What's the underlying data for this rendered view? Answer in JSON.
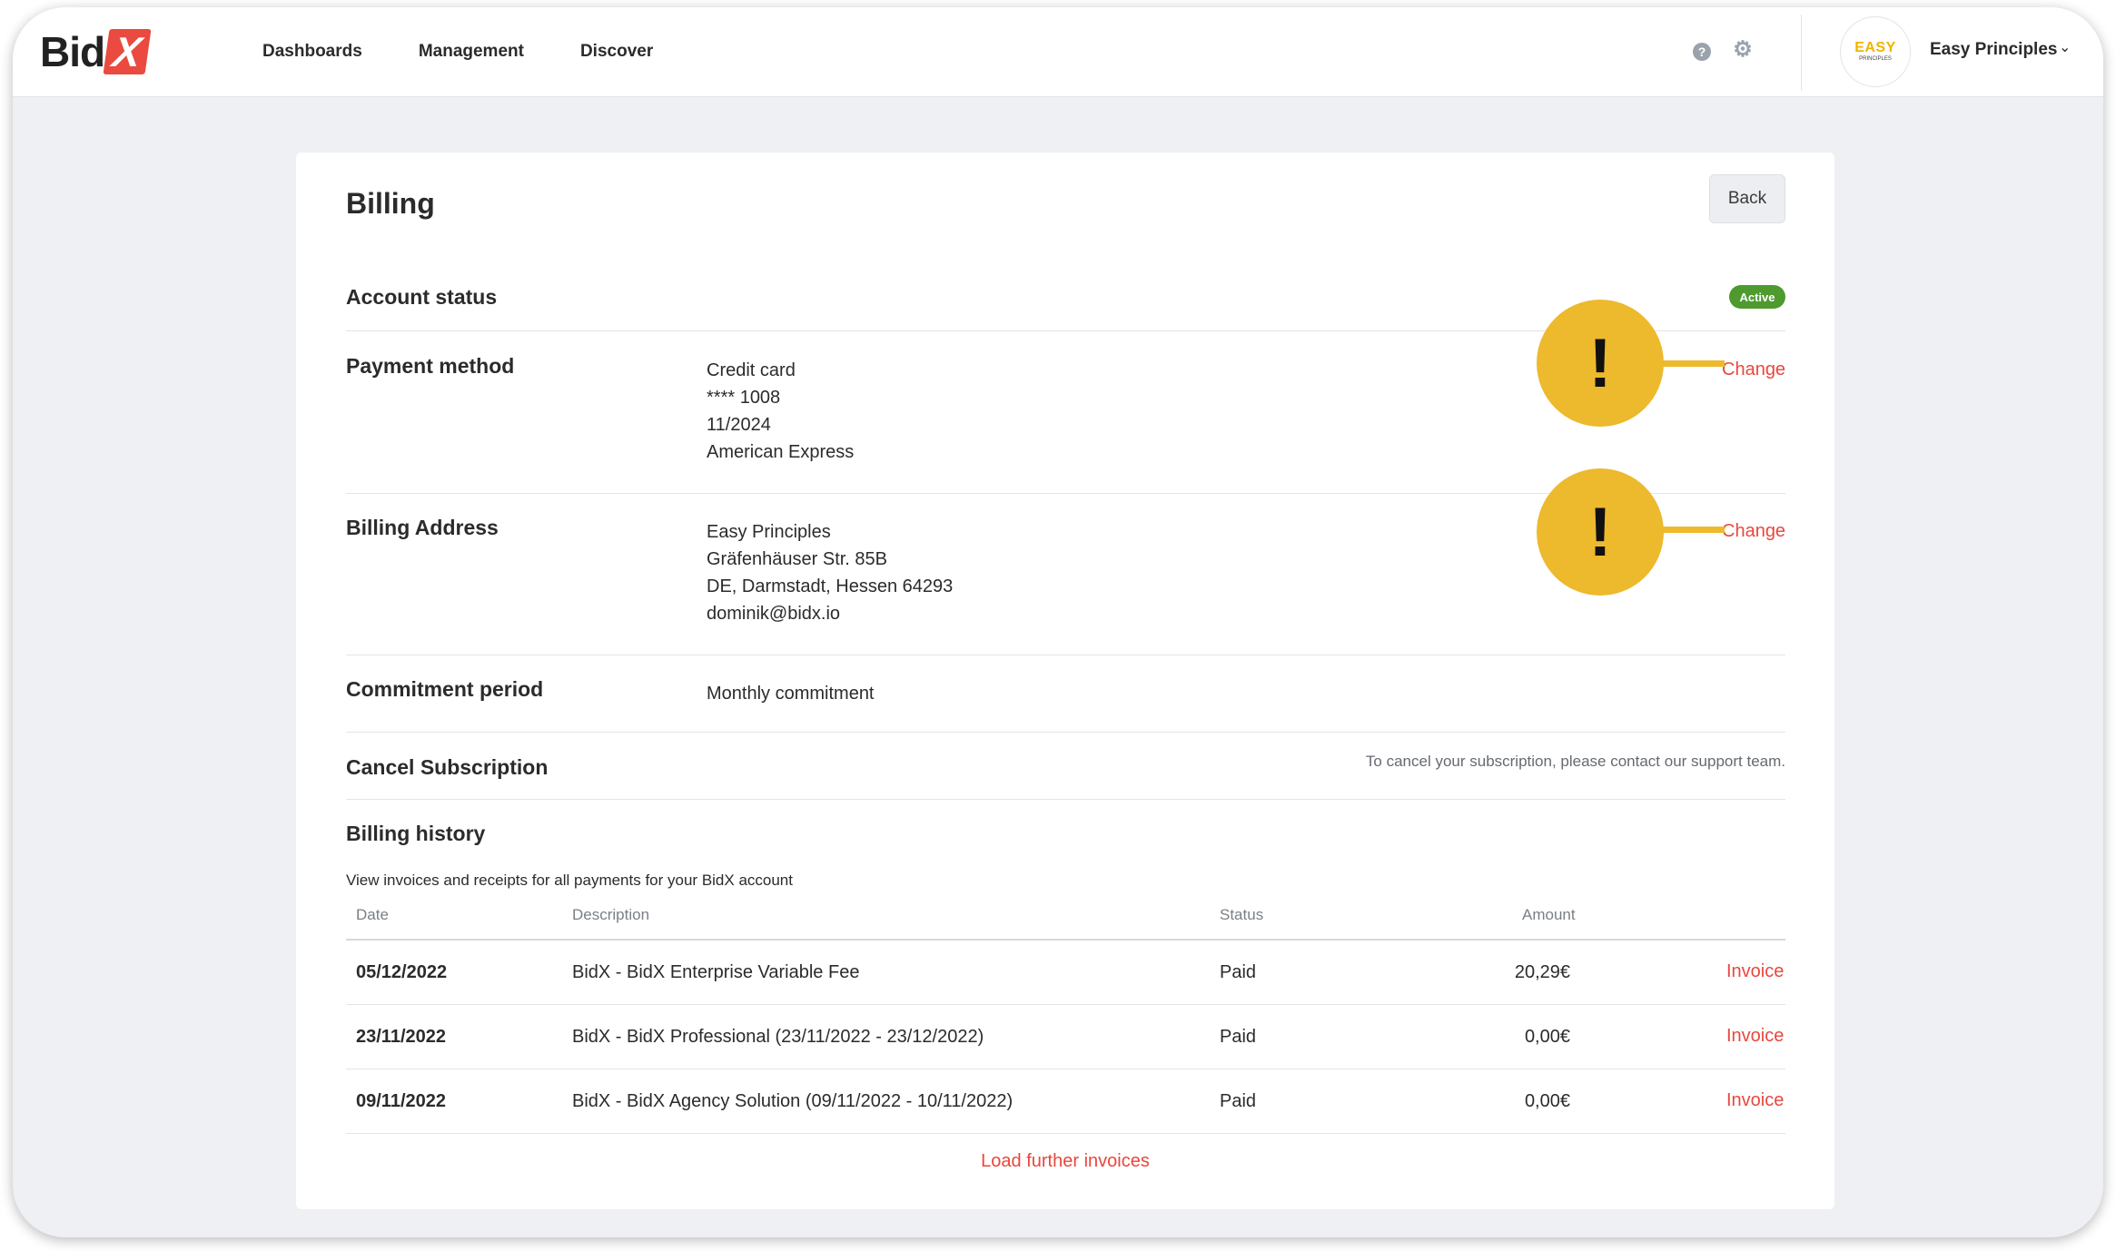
{
  "app": {
    "logo_text": "Bid",
    "logo_mark": "X"
  },
  "nav": {
    "items": [
      {
        "label": "Dashboards"
      },
      {
        "label": "Management"
      },
      {
        "label": "Discover"
      }
    ],
    "help_icon": "question-circle-icon",
    "settings_icon": "gear-icon",
    "avatar_line1": "EASY",
    "avatar_line2": "PRINCIPLES",
    "user_name": "Easy Principles",
    "dropdown_icon": "chevron-down-icon"
  },
  "page": {
    "title": "Billing",
    "back_label": "Back"
  },
  "account_status": {
    "label": "Account status",
    "badge": "Active",
    "badge_color": "#4e9a2e"
  },
  "payment_method": {
    "label": "Payment method",
    "lines": [
      "Credit card",
      "**** 1008",
      "11/2024",
      "American Express"
    ],
    "change_label": "Change"
  },
  "billing_address": {
    "label": "Billing Address",
    "lines": [
      "Easy Principles",
      "Gräfenhäuser Str. 85B",
      "DE, Darmstadt, Hessen 64293",
      "dominik@bidx.io"
    ],
    "change_label": "Change"
  },
  "commitment": {
    "label": "Commitment period",
    "value": "Monthly commitment"
  },
  "cancel": {
    "label": "Cancel Subscription",
    "note": "To cancel your subscription, please contact our support team."
  },
  "history": {
    "title": "Billing history",
    "description": "View invoices and receipts for all payments for your BidX account",
    "columns": {
      "date": "Date",
      "description": "Description",
      "status": "Status",
      "amount": "Amount"
    },
    "rows": [
      {
        "date": "05/12/2022",
        "description": "BidX - BidX Enterprise Variable Fee",
        "status": "Paid",
        "amount": "20,29€",
        "link": "Invoice"
      },
      {
        "date": "23/11/2022",
        "description": "BidX - BidX Professional (23/11/2022 - 23/12/2022)",
        "status": "Paid",
        "amount": "0,00€",
        "link": "Invoice"
      },
      {
        "date": "09/11/2022",
        "description": "BidX - BidX Agency Solution (09/11/2022 - 10/11/2022)",
        "status": "Paid",
        "amount": "0,00€",
        "link": "Invoice"
      }
    ],
    "load_more": "Load further invoices"
  },
  "annotations": {
    "marker_symbol": "!",
    "marker_color": "#edb92d",
    "accent_color": "#e8473e"
  }
}
